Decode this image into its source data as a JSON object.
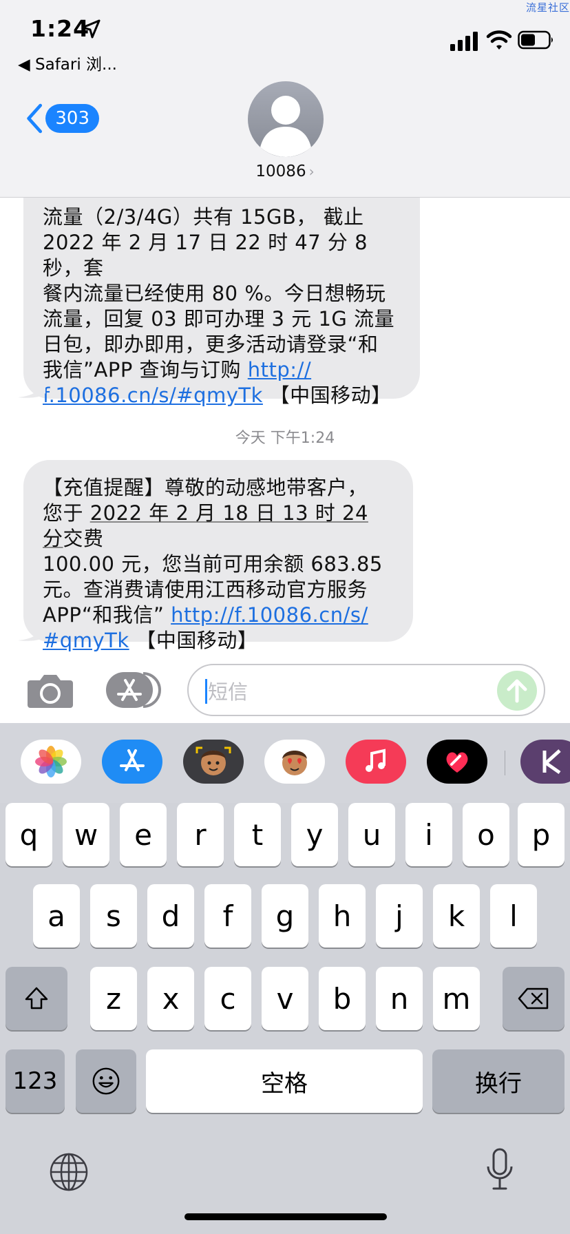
{
  "watermark": "流星社区",
  "status_bar": {
    "time": "1:24",
    "back_app": "◀ Safari 浏..."
  },
  "nav": {
    "back_count": "303",
    "contact": "10086",
    "contact_chevron": "›"
  },
  "messages": [
    {
      "lines_top": [
        "流量（2/3/4G）共有 15GB， 截止",
        "2022 年 2 月 17 日 22 时 47 分 8 秒，套",
        "餐内流量已经使用 80 %。今日想畅玩",
        "流量，回复 03 即可办理 3 元 1G 流量",
        "日包，即办即用，更多活动请登录“和",
        "我信”APP 查询与订购 "
      ],
      "link_part1": "http://",
      "link_part2": "f.10086.cn/s/#qmyTk",
      "suffix": " 【中国移动】"
    },
    {
      "line1": "【充值提醒】尊敬的动感地带客户，",
      "line2_pre": "您于 ",
      "line2_date": "2022 年 2 月 18 日 13 时 24 分",
      "line2_post": "交费",
      "line3": "100.00 元，您当前可用余额 683.85",
      "line4": "元。查消费请使用江西移动官方服务",
      "line5_pre": "APP“和我信” ",
      "link_part1": "http://f.10086.cn/s/",
      "link_part2": "#qmyTk",
      "suffix": " 【中国移动】"
    }
  ],
  "timestamp": "今天 下午1:24",
  "input": {
    "placeholder": "短信"
  },
  "app_strip": [
    "photos-icon",
    "app-store-icon",
    "memoji-icon",
    "memoji-stickers-icon",
    "music-icon",
    "digital-touch-icon",
    "app-k-icon"
  ],
  "keyboard": {
    "row1": [
      "q",
      "w",
      "e",
      "r",
      "t",
      "y",
      "u",
      "i",
      "o",
      "p"
    ],
    "row2": [
      "a",
      "s",
      "d",
      "f",
      "g",
      "h",
      "j",
      "k",
      "l"
    ],
    "row3": [
      "z",
      "x",
      "c",
      "v",
      "b",
      "n",
      "m"
    ],
    "numbers_label": "123",
    "space_label": "空格",
    "return_label": "换行"
  },
  "colors": {
    "accent": "#1a84ff",
    "bubble": "#e9e9eb",
    "link": "#1d6fe0"
  }
}
